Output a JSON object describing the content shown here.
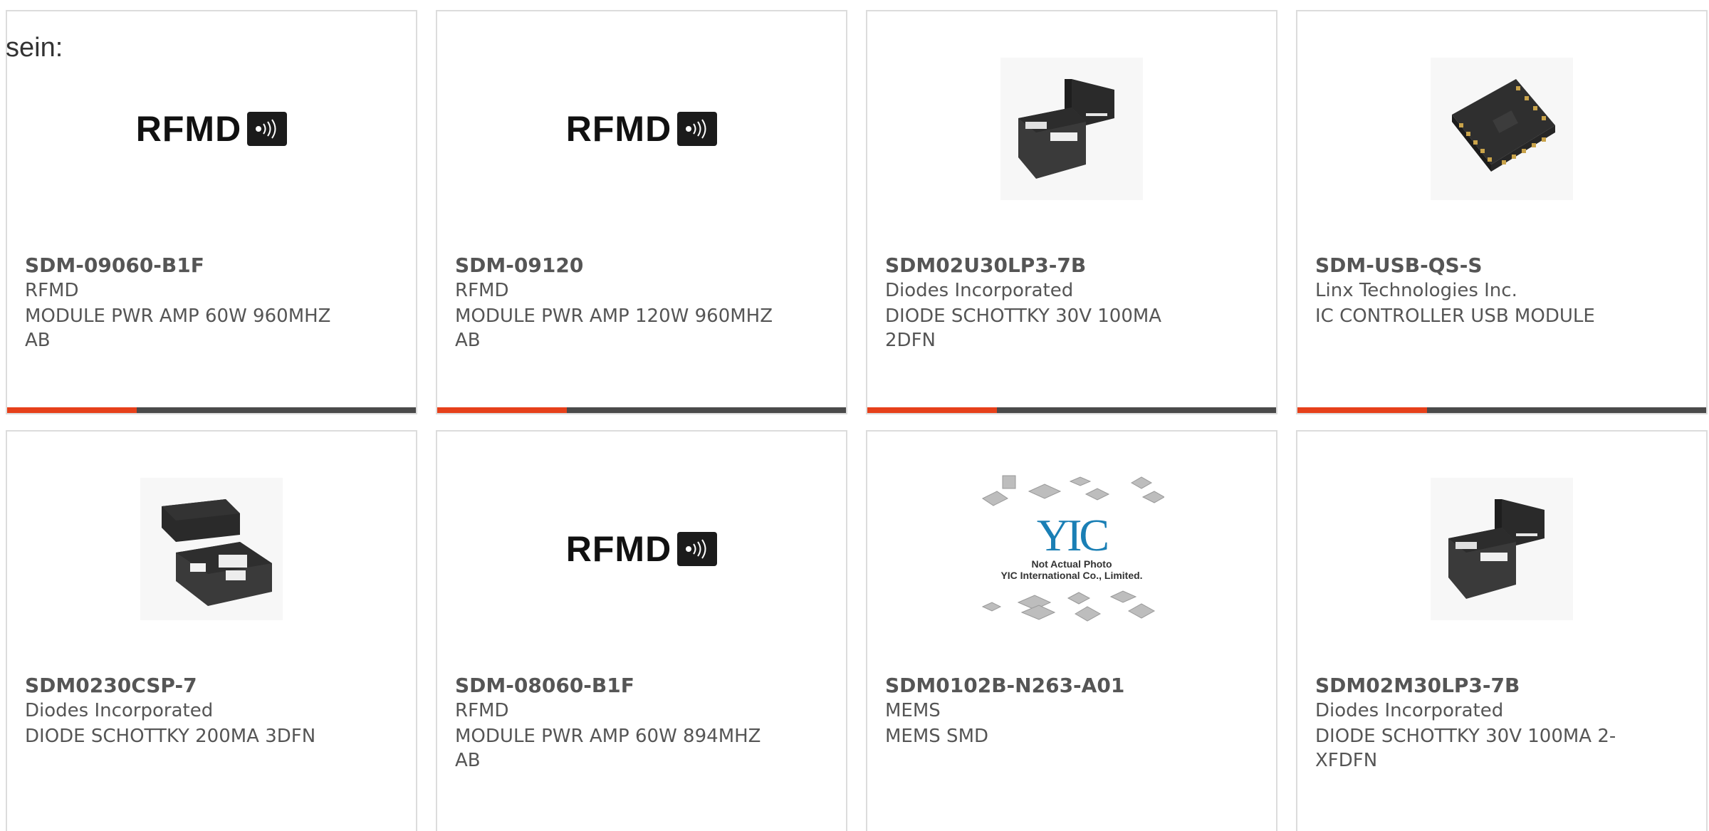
{
  "intro_text": "sein:",
  "cards": [
    {
      "part": "SDM-09060-B1F",
      "maker": "RFMD",
      "desc": "MODULE PWR AMP 60W 960MHZ AB",
      "image": "rfmd-logo"
    },
    {
      "part": "SDM-09120",
      "maker": "RFMD",
      "desc": "MODULE PWR AMP 120W 960MHZ AB",
      "image": "rfmd-logo"
    },
    {
      "part": "SDM02U30LP3-7B",
      "maker": "Diodes Incorporated",
      "desc": "DIODE SCHOTTKY 30V 100MA 2DFN",
      "image": "dfn-package-photo"
    },
    {
      "part": "SDM-USB-QS-S",
      "maker": "Linx Technologies Inc.",
      "desc": "IC CONTROLLER USB MODULE",
      "image": "module-photo"
    },
    {
      "part": "SDM0230CSP-7",
      "maker": "Diodes Incorporated",
      "desc": "DIODE SCHOTTKY 200MA 3DFN",
      "image": "dfn-package-photo"
    },
    {
      "part": "SDM-08060-B1F",
      "maker": "RFMD",
      "desc": "MODULE PWR AMP 60W 894MHZ AB",
      "image": "rfmd-logo"
    },
    {
      "part": "SDM0102B-N263-A01",
      "maker": "MEMS",
      "desc": "MEMS SMD",
      "image": "yic-placeholder"
    },
    {
      "part": "SDM02M30LP3-7B",
      "maker": "Diodes Incorporated",
      "desc": "DIODE SCHOTTKY 30V 100MA 2-XFDFN",
      "image": "dfn-package-photo"
    }
  ],
  "rfmd_logo_text": "RFMD",
  "yic_logo_text": "YIC",
  "yic_caption_1": "Not Actual Photo",
  "yic_caption_2": "YIC International Co., Limited.",
  "colors": {
    "accent": "#e6401a",
    "bar": "#4a4a4a",
    "border": "#dcdcdc",
    "text": "#555555"
  }
}
